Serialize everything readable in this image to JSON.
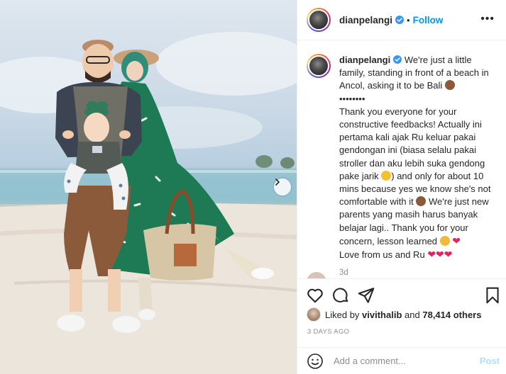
{
  "photo": {
    "alt_icon": "photo-content",
    "next_icon": "chevron-right-icon"
  },
  "header": {
    "username": "dianpelangi",
    "separator": "•",
    "follow_label": "Follow",
    "more_label": "•••"
  },
  "caption": {
    "username": "dianpelangi",
    "line1": "We're just a little family, standing in front of a beach in Ancol, asking it to be Bali",
    "divider": "••••••••",
    "line2a": "Thank you everyone for your constructive feedbacks! Actually ini pertama kali ajak Ru keluar pakai gendongan ini (biasa selalu pakai stroller dan aku lebih suka gendong pake jarik",
    "line2b": ") and only for about 10 mins because yes we know she's not comfortable with it",
    "line2c": "We're just new parents yang masih harus banyak belajar lagi.. Thank you for your concern, lesson learned",
    "line3": "Love from us and Ru",
    "time_ago": "3d"
  },
  "actions": {
    "like_icon": "heart-icon",
    "comment_icon": "comment-icon",
    "share_icon": "share-icon",
    "save_icon": "bookmark-icon"
  },
  "likes": {
    "prefix": "Liked by ",
    "user": "vivithalib",
    "middle": " and ",
    "count": "78,414 others"
  },
  "date": "3 DAYS AGO",
  "comment": {
    "placeholder": "Add a comment...",
    "post_label": "Post"
  },
  "colors": {
    "accent": "#0095f6",
    "post_disabled": "#b2dffc",
    "heart": "#e0245e",
    "muted": "#8e8e8e"
  }
}
